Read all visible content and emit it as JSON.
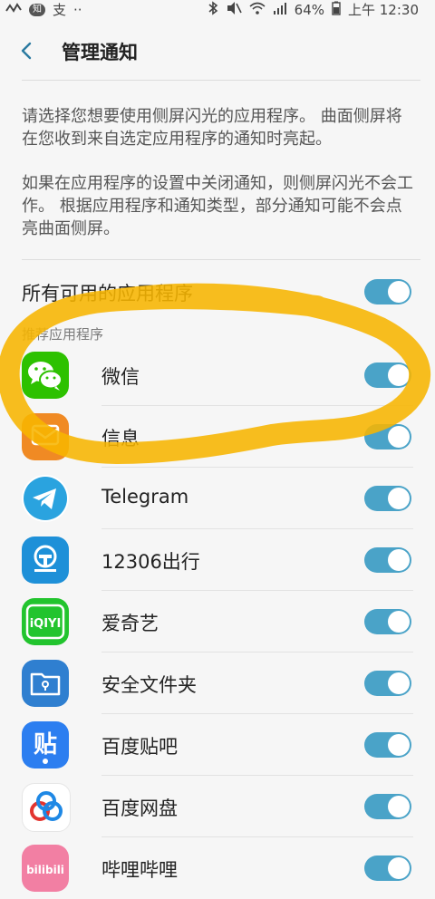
{
  "status_bar": {
    "left_badge": "知",
    "left_text": "支",
    "dots": "··",
    "battery": "64%",
    "time": "上午 12:30"
  },
  "header": {
    "title": "管理通知"
  },
  "description": {
    "para1": "请选择您想要使用侧屏闪光的应用程序。 曲面侧屏将在您收到来自选定应用程序的通知时亮起。",
    "para2": "如果在应用程序的设置中关闭通知，则侧屏闪光不会工作。 根据应用程序和通知类型，部分通知可能不会点亮曲面侧屏。"
  },
  "all_apps": {
    "label": "所有可用的应用程序",
    "enabled": true
  },
  "section": {
    "label": "推荐应用程序"
  },
  "apps": [
    {
      "name": "微信",
      "enabled": true
    },
    {
      "name": "信息",
      "enabled": true
    },
    {
      "name": "Telegram",
      "enabled": true
    },
    {
      "name": "12306出行",
      "enabled": true
    },
    {
      "name": "爱奇艺",
      "enabled": true
    },
    {
      "name": "安全文件夹",
      "enabled": true
    },
    {
      "name": "百度贴吧",
      "enabled": true
    },
    {
      "name": "百度网盘",
      "enabled": true
    },
    {
      "name": "哔哩哔哩",
      "enabled": true
    }
  ],
  "icons": {
    "wechat": {
      "label": "",
      "color": "#2dc100"
    },
    "messages": {
      "label": "",
      "color": "#f08a24"
    },
    "telegram": {
      "label": "",
      "color": "#2aa3df"
    },
    "railway": {
      "label": "",
      "color": "#1e90d8"
    },
    "iqiyi": {
      "label": "iQIYI",
      "color": "#22c42e"
    },
    "secure_folder": {
      "label": "",
      "color": "#2f7fd0"
    },
    "tieba": {
      "label": "贴",
      "color": "#2c7ef0"
    },
    "netdisk": {
      "label": "",
      "color": "#ffffff"
    },
    "bilibili": {
      "label": "bilibili",
      "color": "#f27fa3"
    }
  },
  "colors": {
    "toggle_on": "#4aa3c8",
    "annotation": "#f7b500"
  }
}
